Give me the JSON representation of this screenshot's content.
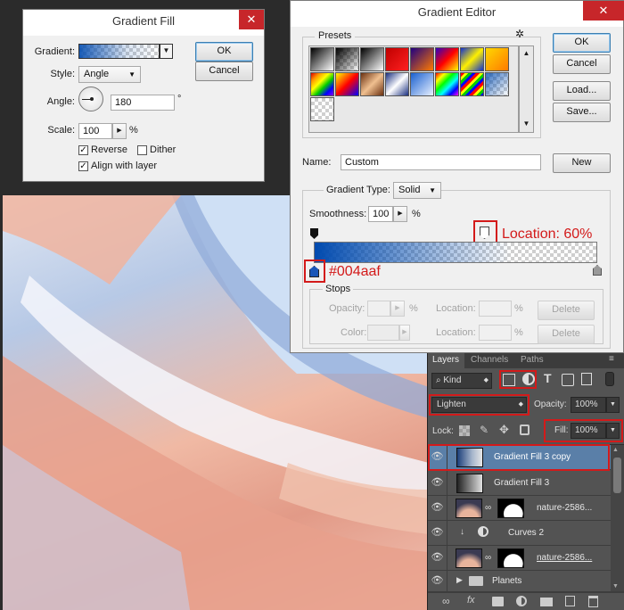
{
  "gradient_fill": {
    "title": "Gradient Fill",
    "gradient_label": "Gradient:",
    "style_label": "Style:",
    "style_value": "Angle",
    "angle_label": "Angle:",
    "angle_value": "180",
    "degree_symbol": "°",
    "scale_label": "Scale:",
    "scale_value": "100",
    "scale_unit": "%",
    "reverse_label": "Reverse",
    "reverse_checked": true,
    "dither_label": "Dither",
    "dither_checked": false,
    "align_label": "Align with layer",
    "align_checked": true,
    "ok_label": "OK",
    "cancel_label": "Cancel",
    "close_glyph": "✕"
  },
  "gradient_editor": {
    "title": "Gradient Editor",
    "presets_label": "Presets",
    "ok_label": "OK",
    "cancel_label": "Cancel",
    "load_label": "Load...",
    "save_label": "Save...",
    "name_label": "Name:",
    "name_value": "Custom",
    "new_label": "New",
    "gradient_type_label": "Gradient Type:",
    "gradient_type_value": "Solid",
    "smoothness_label": "Smoothness:",
    "smoothness_value": "100",
    "smoothness_unit": "%",
    "location_annotation": "Location: 60%",
    "color_annotation": "#004aaf",
    "stops_label": "Stops",
    "opacity_label": "Opacity:",
    "color_label": "Color:",
    "location_label_1": "Location:",
    "location_label_2": "Location:",
    "pct_1": "%",
    "pct_2": "%",
    "pct_3": "%",
    "delete_label_1": "Delete",
    "delete_label_2": "Delete",
    "close_glyph": "✕",
    "gradient_color": "#004aaf",
    "color_stop_location_pct": 0,
    "opacity_stop_location_pct": 60
  },
  "layers_panel": {
    "tabs": [
      "Layers",
      "Channels",
      "Paths"
    ],
    "kind_label": "Kind",
    "blend_mode": "Lighten",
    "opacity_label": "Opacity:",
    "opacity_value": "100%",
    "lock_label": "Lock:",
    "fill_label": "Fill:",
    "fill_value": "100%",
    "layers": [
      {
        "name": "Gradient Fill 3 copy",
        "selected": true
      },
      {
        "name": "Gradient Fill 3",
        "selected": false
      },
      {
        "name": "nature-2586...",
        "selected": false
      },
      {
        "name": "Curves 2",
        "selected": false
      },
      {
        "name": "nature-2586...",
        "selected": false
      },
      {
        "name": "Planets",
        "selected": false
      }
    ]
  }
}
